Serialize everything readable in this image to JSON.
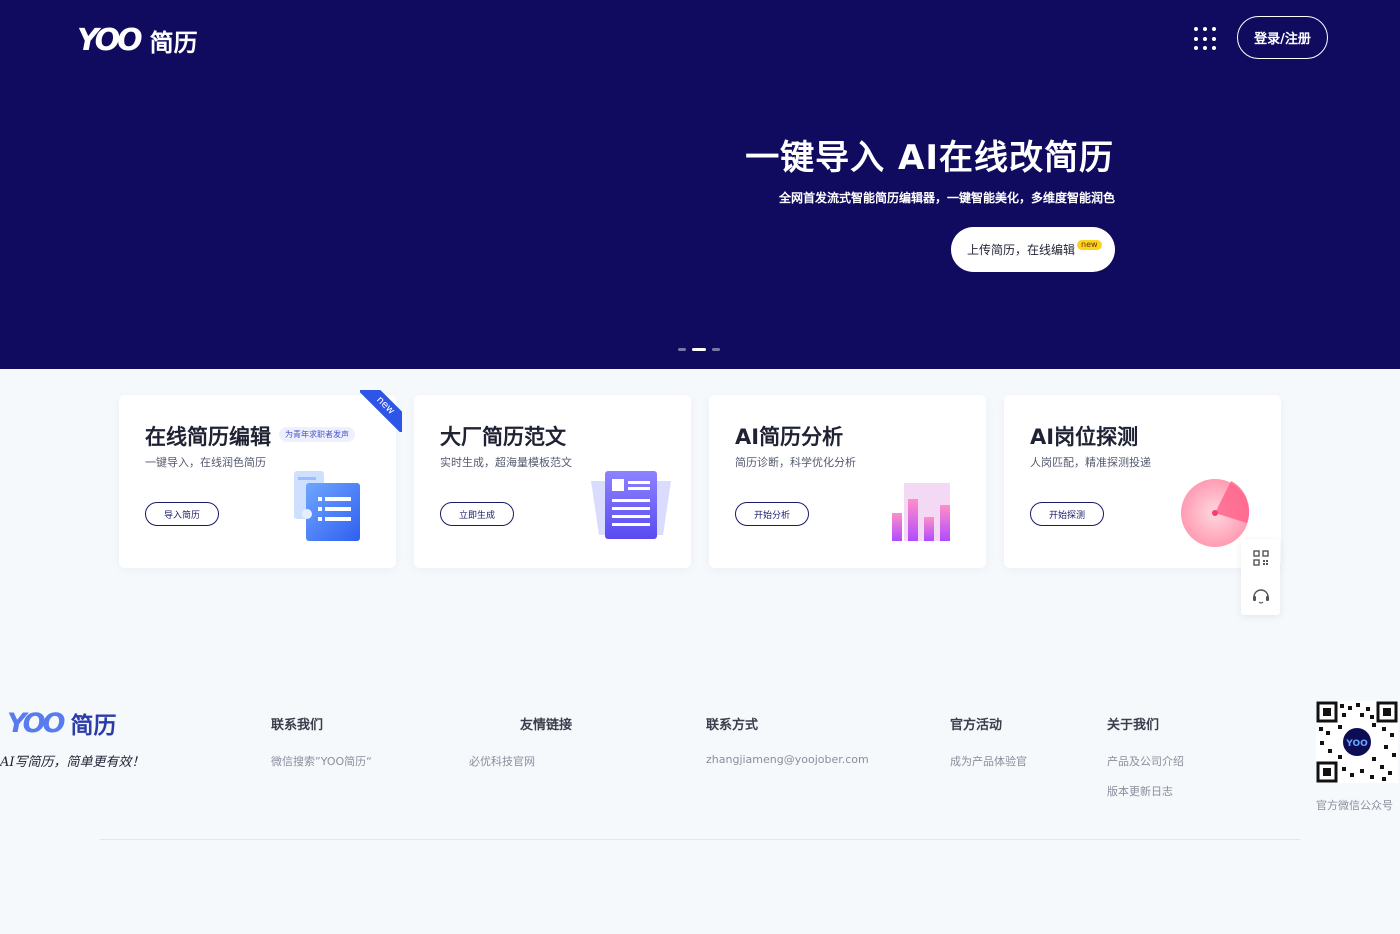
{
  "header": {
    "logo_text": "YOO",
    "logo_cn": "简历",
    "login_label": "登录/注册"
  },
  "hero": {
    "title": "一键导入 AI在线改简历",
    "subtitle": "全网首发流式智能简历编辑器，一键智能美化，多维度智能润色",
    "cta_label": "上传简历，在线编辑",
    "cta_badge": "new",
    "carousel_count": 3,
    "carousel_active": 2
  },
  "cards": [
    {
      "title": "在线简历编辑",
      "tag": "为青年求职者发声",
      "desc": "一键导入，在线润色简历",
      "button": "导入简历",
      "ribbon": "new",
      "icon": "document-list-icon"
    },
    {
      "title": "大厂简历范文",
      "desc": "实时生成，超海量模板范文",
      "button": "立即生成",
      "icon": "template-doc-icon"
    },
    {
      "title": "AI简历分析",
      "desc": "简历诊断，科学优化分析",
      "button": "开始分析",
      "icon": "bar-chart-icon"
    },
    {
      "title": "AI岗位探测",
      "desc": "人岗匹配，精准探测投递",
      "button": "开始探测",
      "icon": "radar-icon"
    }
  ],
  "side_tools": [
    "qr-code-icon",
    "customer-service-icon"
  ],
  "footer": {
    "logo_text": "YOO",
    "logo_cn": "简历",
    "slogan": "AI写简历，简单更有效！",
    "columns": [
      {
        "head": "联系我们",
        "links": [
          "微信搜索”YOO简历“"
        ]
      },
      {
        "head": "友情链接",
        "links": [
          "必优科技官网"
        ]
      },
      {
        "head": "联系方式",
        "links": [
          "zhangjiameng@yoojober.com"
        ]
      },
      {
        "head": "官方活动",
        "links": [
          "成为产品体验官"
        ]
      },
      {
        "head": "关于我们",
        "links": [
          "产品及公司介绍",
          "版本更新日志"
        ]
      }
    ],
    "qr_label": "官方微信公众号"
  },
  "colors": {
    "hero_bg": "#100b5e",
    "accent_blue": "#2e55e8",
    "button_border": "#1a1a6b"
  }
}
